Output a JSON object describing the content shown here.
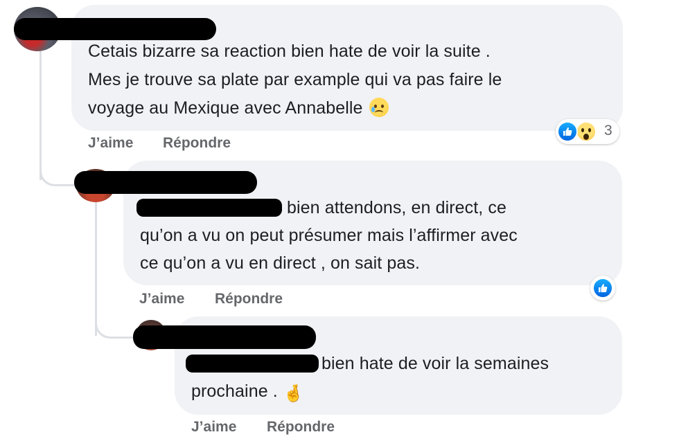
{
  "comments": [
    {
      "text_lines": [
        "Cetais bizarre sa reaction bien hate de voir la suite .",
        "Mes je trouve sa plate par example qui va pas faire le",
        "voyage au Mexique avec Annabelle"
      ],
      "emoji": "sad-tear-face",
      "reactions": {
        "icons": [
          "like-icon",
          "wow-icon"
        ],
        "count": "3"
      },
      "actions": {
        "like": "J’aime",
        "reply": "Répondre"
      }
    },
    {
      "text_lines": [
        "bien attendons, en direct, ce",
        "qu’on a vu on peut présumer mais l’affirmer avec",
        "ce qu’on a vu en direct , on sait pas."
      ],
      "reactions": {
        "icons": [
          "like-icon"
        ]
      },
      "actions": {
        "like": "J’aime",
        "reply": "Répondre"
      }
    },
    {
      "text_lines": [
        "bien hate de voir la semaines",
        "prochaine ."
      ],
      "emoji": "crossed-fingers",
      "actions": {
        "like": "J’aime",
        "reply": "Répondre"
      }
    }
  ],
  "colors": {
    "bubble": "#f0f2f5",
    "text": "#1c1e21",
    "action": "#65676b",
    "like_blue": "#0866ff"
  }
}
